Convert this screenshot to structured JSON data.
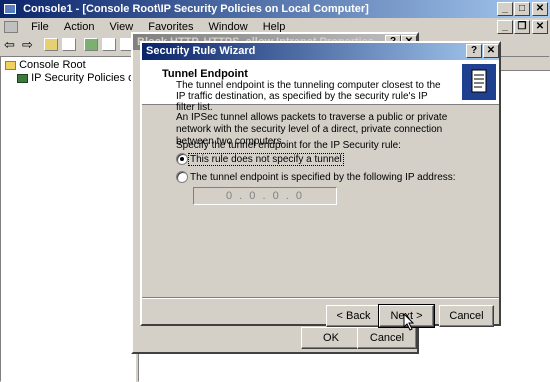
{
  "main_window": {
    "title": "Console1 - [Console Root\\IP Security Policies on Local Computer]",
    "menu": [
      "File",
      "Action",
      "View",
      "Favorites",
      "Window",
      "Help"
    ]
  },
  "tree": {
    "root": "Console Root",
    "child": "IP Security Policies on Local C"
  },
  "back_dialog": {
    "title": "Block HTTP, HTTPS, allow Intranet Properties",
    "ok_label": "OK",
    "cancel_label": "Cancel"
  },
  "wizard": {
    "title": "Security Rule Wizard",
    "header_title": "Tunnel Endpoint",
    "header_desc": "The tunnel endpoint is the tunneling computer closest to the IP traffic destination, as specified by the security rule's IP filter list.",
    "intro": "An IPSec tunnel allows packets to traverse a public or private network with the security level of a direct, private connection between two computers.",
    "prompt": "Specify the tunnel endpoint for the IP Security rule:",
    "option1": "This rule does not specify a tunnel",
    "option2": "The tunnel endpoint is specified by the following IP address:",
    "ip_value": "0 . 0 . 0 . 0",
    "back_label": "< Back",
    "next_label": "Next >",
    "cancel_label": "Cancel"
  }
}
